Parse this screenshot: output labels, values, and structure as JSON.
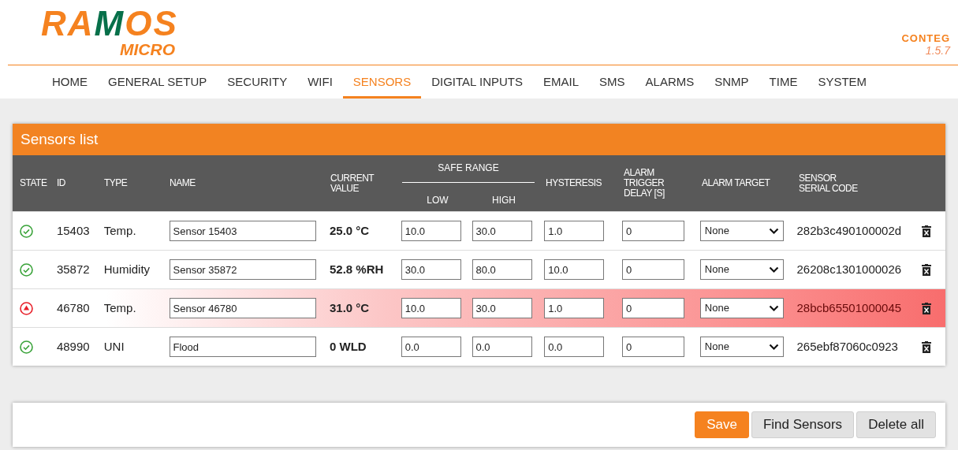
{
  "header": {
    "logo": "RAMOS",
    "logo_sub": "MICRO",
    "brand": "CONTEG",
    "version": "1.5.7"
  },
  "nav": [
    {
      "label": "HOME",
      "selected": false
    },
    {
      "label": "GENERAL SETUP",
      "selected": false
    },
    {
      "label": "SECURITY",
      "selected": false
    },
    {
      "label": "WIFI",
      "selected": false
    },
    {
      "label": "SENSORS",
      "selected": true
    },
    {
      "label": "DIGITAL INPUTS",
      "selected": false
    },
    {
      "label": "EMAIL",
      "selected": false
    },
    {
      "label": "SMS",
      "selected": false
    },
    {
      "label": "ALARMS",
      "selected": false
    },
    {
      "label": "SNMP",
      "selected": false
    },
    {
      "label": "TIME",
      "selected": false
    },
    {
      "label": "SYSTEM",
      "selected": false
    }
  ],
  "panel": {
    "title": "Sensors list",
    "columns": {
      "state": "STATE",
      "id": "ID",
      "type": "TYPE",
      "name": "NAME",
      "current": "CURRENT VALUE",
      "safe_range": "SAFE RANGE",
      "low": "LOW",
      "high": "HIGH",
      "hysteresis": "HYSTERESIS",
      "delay": "ALARM TRIGGER DELAY [S]",
      "target": "ALARM TARGET",
      "serial": "SENSOR SERIAL CODE"
    },
    "rows": [
      {
        "alarm": false,
        "id": "15403",
        "type": "Temp.",
        "name": "Sensor 15403",
        "current": "25.0 °C",
        "low": "10.0",
        "high": "30.0",
        "hysteresis": "1.0",
        "delay": "0",
        "target": "None",
        "serial": "282b3c490100002d"
      },
      {
        "alarm": false,
        "id": "35872",
        "type": "Humidity",
        "name": "Sensor 35872",
        "current": "52.8 %RH",
        "low": "30.0",
        "high": "80.0",
        "hysteresis": "10.0",
        "delay": "0",
        "target": "None",
        "serial": "26208c1301000026"
      },
      {
        "alarm": true,
        "id": "46780",
        "type": "Temp.",
        "name": "Sensor 46780",
        "current": "31.0 °C",
        "low": "10.0",
        "high": "30.0",
        "hysteresis": "1.0",
        "delay": "0",
        "target": "None",
        "serial": "28bcb65501000045"
      },
      {
        "alarm": false,
        "id": "48990",
        "type": "UNI",
        "name": "Flood",
        "current": "0 WLD",
        "low": "0.0",
        "high": "0.0",
        "hysteresis": "0.0",
        "delay": "0",
        "target": "None",
        "serial": "265ebf87060c0923"
      }
    ]
  },
  "buttons": [
    {
      "label": "Save",
      "kind": "primary"
    },
    {
      "label": "Find Sensors",
      "kind": "secondary"
    },
    {
      "label": "Delete all",
      "kind": "secondary"
    }
  ]
}
